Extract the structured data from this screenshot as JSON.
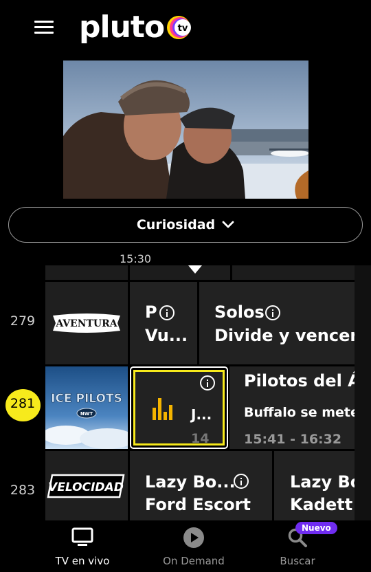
{
  "header": {
    "menu_icon": "hamburger-menu-icon",
    "logo_text": "pluto",
    "logo_badge": "tv"
  },
  "category": {
    "label": "Curiosidad",
    "icon": "chevron-down-icon"
  },
  "timeline": {
    "time_label": "15:30"
  },
  "guide": {
    "rows": [
      {
        "channel_number": "279",
        "channel_name": "AVENTURA",
        "programs": [
          {
            "title": "P",
            "subtitle": "Vu..."
          },
          {
            "title": "Solos",
            "subtitle": "Divide y vencerás"
          }
        ]
      },
      {
        "channel_number": "281",
        "channel_name": "ICE PILOTS",
        "channel_badge": "NWT",
        "programs": [
          {
            "title": "J...",
            "time": "14"
          },
          {
            "title": "Pilotos del Ártico",
            "subtitle": "Buffalo se mete en",
            "time": "15:41 - 16:32"
          }
        ]
      },
      {
        "channel_number": "283",
        "channel_name": "VELOCIDAD",
        "programs": [
          {
            "title": "Lazy Bo...",
            "subtitle": "Ford Escort"
          },
          {
            "title": "Lazy Bo",
            "subtitle": "Kadett"
          }
        ]
      }
    ]
  },
  "bottom_nav": {
    "items": [
      {
        "label": "TV en vivo",
        "icon": "tv-icon",
        "active": true
      },
      {
        "label": "On Demand",
        "icon": "play-circle-icon",
        "active": false
      },
      {
        "label": "Buscar",
        "icon": "search-icon",
        "active": false,
        "badge": "Nuevo"
      }
    ]
  },
  "colors": {
    "background": "#000000",
    "cell": "#222222",
    "selected_channel": "#f7ea1c",
    "focus_border": "#ffffff",
    "badge": "#6f2cf0"
  }
}
